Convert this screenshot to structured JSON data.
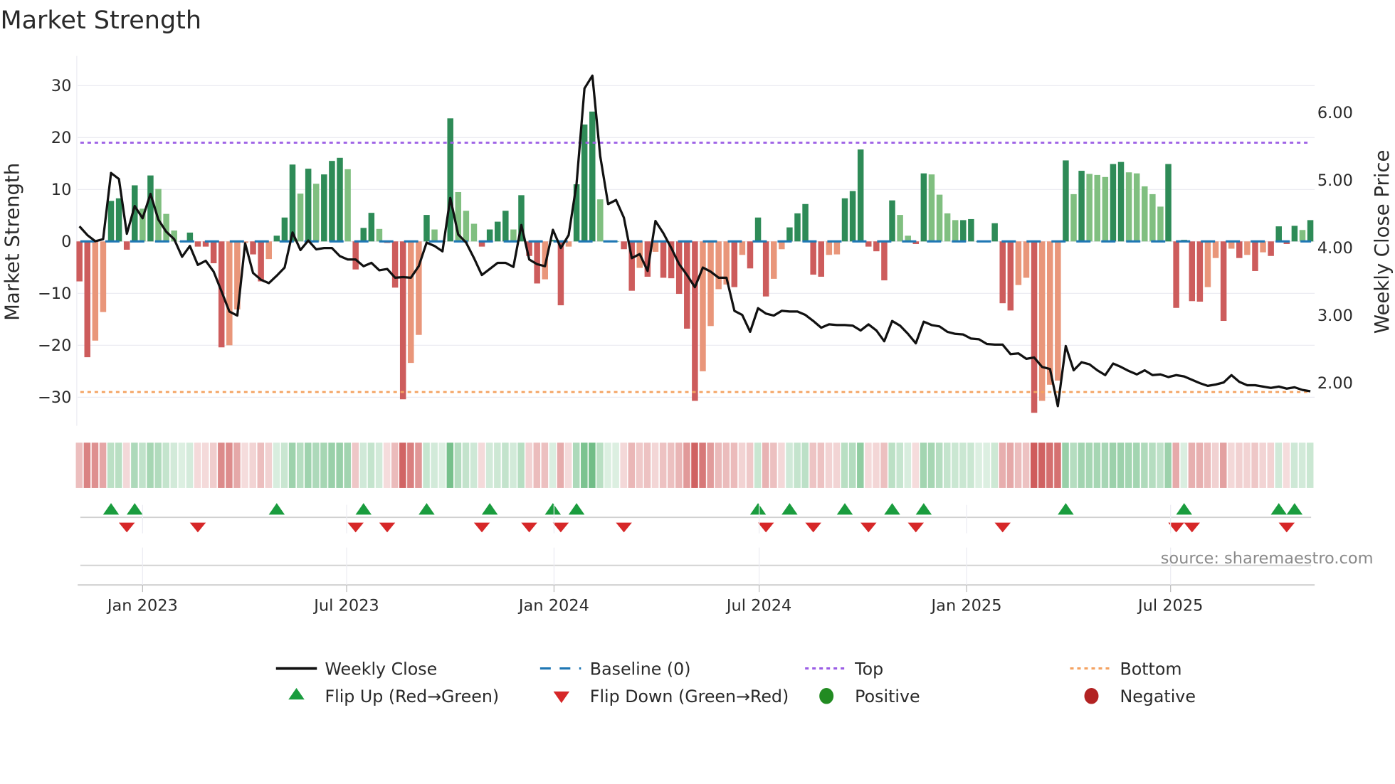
{
  "chart_data": {
    "type": "bar",
    "title": "Market Strength",
    "ylabel": "Market Strength",
    "y2label": "Weekly Close Price",
    "source": "source: sharemaestro.com",
    "start_date": "2022-11-06",
    "interval_days": 7,
    "ylim": [
      -35.5,
      35.7
    ],
    "y2lim": [
      1.37,
      6.84
    ],
    "yticks": [
      30,
      20,
      10,
      0,
      -10,
      -20,
      -30
    ],
    "ytick_labels": [
      "30",
      "20",
      "10",
      "0",
      "−10",
      "−20",
      "−30"
    ],
    "y2ticks": [
      2,
      3,
      4,
      5,
      6
    ],
    "y2tick_labels": [
      "2.00",
      "3.00",
      "4.00",
      "5.00",
      "6.00"
    ],
    "xticks": [
      {
        "date": "2023-01-01",
        "label": "Jan 2023"
      },
      {
        "date": "2023-07-01",
        "label": "Jul 2023"
      },
      {
        "date": "2024-01-01",
        "label": "Jan 2024"
      },
      {
        "date": "2024-07-01",
        "label": "Jul 2024"
      },
      {
        "date": "2025-01-01",
        "label": "Jan 2025"
      },
      {
        "date": "2025-07-01",
        "label": "Jul 2025"
      }
    ],
    "top_level": 19,
    "bottom_level": -29,
    "baseline": 0,
    "strength": [
      -7.7,
      -22.3,
      -19.1,
      -13.6,
      7.8,
      8.3,
      -1.6,
      10.8,
      6.3,
      12.7,
      10.1,
      5.3,
      2.1,
      0,
      1.7,
      -1,
      -1,
      -4.2,
      -20.4,
      -20,
      -13.1,
      -0.3,
      -2.5,
      -7.7,
      -3.4,
      1.1,
      4.6,
      14.8,
      9.2,
      14,
      11.1,
      12.9,
      15.5,
      16.1,
      13.9,
      -5.4,
      2.6,
      5.5,
      2.4,
      -0.3,
      -8.9,
      -30.4,
      -23.4,
      -18,
      5.1,
      2.3,
      0,
      23.7,
      9.5,
      5.9,
      3.4,
      -1,
      2.3,
      3.8,
      5.9,
      2.3,
      8.9,
      -2.8,
      -8.1,
      -7.3,
      0.3,
      -12.3,
      -1,
      11,
      22.5,
      25,
      8.1,
      0,
      0,
      -1.5,
      -9.5,
      -5.1,
      -6.8,
      -2,
      -7,
      -7.1,
      -10.1,
      -16.8,
      -30.7,
      -25,
      -16.3,
      -9.2,
      -8.3,
      -8.8,
      -2.6,
      -5.2,
      4.6,
      -10.6,
      -7.2,
      -1.5,
      2.7,
      5.4,
      7.2,
      -6.4,
      -6.8,
      -2.6,
      -2.5,
      8.3,
      9.7,
      17.7,
      -1,
      -1.9,
      -7.5,
      7.9,
      5.1,
      1.1,
      -0.5,
      13.1,
      12.9,
      9,
      5.4,
      4.1,
      4.1,
      4.3,
      0,
      0,
      3.5,
      -11.9,
      -13.3,
      -8.4,
      -7,
      -33,
      -30.7,
      -27.6,
      -26.8,
      15.6,
      9.1,
      13.6,
      13,
      12.8,
      12.4,
      14.9,
      15.3,
      13.3,
      13.1,
      10.6,
      9.1,
      6.7,
      14.9,
      -12.8,
      0.3,
      -11.5,
      -11.6,
      -8.8,
      -3.2,
      -15.3,
      -1.4,
      -3.2,
      -2.6,
      -5.7,
      -2.1,
      -2.8,
      2.9,
      -0.5,
      3,
      2.2,
      4.1
    ],
    "shade": [
      "R",
      "R",
      "r",
      "r",
      "G",
      "G",
      "R",
      "G",
      "g",
      "G",
      "g",
      "g",
      "g",
      "g",
      "G",
      "R",
      "R",
      "R",
      "R",
      "r",
      "r",
      "r",
      "R",
      "R",
      "r",
      "G",
      "G",
      "G",
      "g",
      "G",
      "g",
      "G",
      "G",
      "G",
      "g",
      "R",
      "G",
      "G",
      "g",
      "R",
      "R",
      "R",
      "r",
      "r",
      "G",
      "g",
      "g",
      "G",
      "g",
      "g",
      "g",
      "R",
      "G",
      "G",
      "G",
      "g",
      "G",
      "R",
      "R",
      "r",
      "G",
      "R",
      "r",
      "G",
      "G",
      "G",
      "g",
      "g",
      "g",
      "R",
      "R",
      "r",
      "R",
      "r",
      "R",
      "R",
      "R",
      "R",
      "R",
      "r",
      "r",
      "r",
      "r",
      "R",
      "r",
      "R",
      "G",
      "R",
      "r",
      "r",
      "G",
      "G",
      "G",
      "R",
      "R",
      "r",
      "r",
      "G",
      "G",
      "G",
      "R",
      "R",
      "R",
      "G",
      "g",
      "g",
      "R",
      "G",
      "g",
      "g",
      "g",
      "g",
      "G",
      "G",
      "g",
      "g",
      "G",
      "R",
      "R",
      "r",
      "r",
      "R",
      "r",
      "r",
      "r",
      "G",
      "g",
      "G",
      "g",
      "g",
      "g",
      "G",
      "G",
      "g",
      "g",
      "g",
      "g",
      "g",
      "G",
      "R",
      "G",
      "R",
      "R",
      "r",
      "r",
      "R",
      "r",
      "R",
      "r",
      "R",
      "r",
      "R",
      "G",
      "R",
      "G",
      "g",
      "G"
    ],
    "weekly_close": [
      4.32,
      4.19,
      4.1,
      4.13,
      5.11,
      5.02,
      4.21,
      4.62,
      4.44,
      4.8,
      4.42,
      4.24,
      4.13,
      3.87,
      4.03,
      3.75,
      3.81,
      3.65,
      3.36,
      3.06,
      3.0,
      4.07,
      3.63,
      3.53,
      3.48,
      3.59,
      3.71,
      4.23,
      3.97,
      4.11,
      3.98,
      4.0,
      4.0,
      3.88,
      3.83,
      3.83,
      3.73,
      3.78,
      3.67,
      3.69,
      3.56,
      3.57,
      3.56,
      3.73,
      4.08,
      4.03,
      3.95,
      4.74,
      4.2,
      4.08,
      3.85,
      3.6,
      3.69,
      3.78,
      3.78,
      3.72,
      4.34,
      3.83,
      3.76,
      3.73,
      4.27,
      4.0,
      4.19,
      4.95,
      6.36,
      6.55,
      5.36,
      4.65,
      4.71,
      4.45,
      3.85,
      3.91,
      3.66,
      4.4,
      4.22,
      4.0,
      3.76,
      3.6,
      3.42,
      3.71,
      3.65,
      3.56,
      3.56,
      3.07,
      3.01,
      2.76,
      3.11,
      3.03,
      3.0,
      3.07,
      3.06,
      3.06,
      3.01,
      2.92,
      2.82,
      2.87,
      2.86,
      2.86,
      2.85,
      2.78,
      2.87,
      2.78,
      2.62,
      2.92,
      2.85,
      2.73,
      2.59,
      2.91,
      2.86,
      2.84,
      2.76,
      2.73,
      2.72,
      2.66,
      2.65,
      2.58,
      2.57,
      2.57,
      2.43,
      2.44,
      2.36,
      2.38,
      2.24,
      2.21,
      1.66,
      2.55,
      2.19,
      2.31,
      2.28,
      2.19,
      2.12,
      2.29,
      2.24,
      2.18,
      2.13,
      2.19,
      2.12,
      2.13,
      2.09,
      2.12,
      2.1,
      2.05,
      2.0,
      1.96,
      1.98,
      2.01,
      2.12,
      2.02,
      1.97,
      1.97,
      1.95,
      1.93,
      1.95,
      1.92,
      1.94,
      1.9,
      1.88
    ],
    "flip_up_weeks": [
      4,
      7,
      25,
      36,
      44,
      52,
      60,
      63,
      86,
      90,
      97,
      103,
      107,
      125,
      140,
      152,
      154
    ],
    "flip_down_weeks": [
      6,
      15,
      35,
      39,
      51,
      57,
      61,
      69,
      87,
      93,
      100,
      106,
      117,
      139,
      141,
      153
    ],
    "colors": {
      "G": "#2e8b57",
      "g": "#80bf80",
      "R": "#cd5c5c",
      "r": "#e9967a",
      "close": "#111111",
      "baseline": "#1f77b4",
      "top": "#9b5de5",
      "bottom": "#f4a261",
      "flip_up": "#1a9c3e",
      "flip_down": "#d62728",
      "positive": "#228b22",
      "negative": "#b22222"
    },
    "legend": {
      "placement": "bottom-center",
      "weekly_close": "Weekly Close",
      "baseline": "Baseline (0)",
      "top": "Top",
      "bottom": "Bottom",
      "flip_up": "Flip Up (Red→Green)",
      "flip_down": "Flip Down (Green→Red)",
      "positive": "Positive",
      "negative": "Negative"
    }
  }
}
